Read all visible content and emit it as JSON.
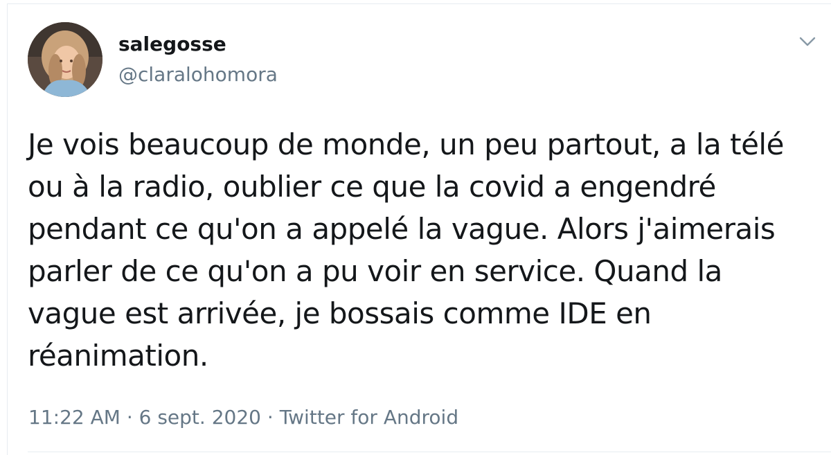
{
  "tweet": {
    "display_name": "salegosse",
    "handle": "@claralohomora",
    "text_lines": [
      "Je vois beaucoup de monde, un peu partout, a la télé",
      "ou à la radio, oublier ce que la covid a engendré",
      "pendant ce qu'on a appelé la vague. Alors j'aimerais",
      "parler de ce qu'on a pu voir en service. Quand la",
      "vague est arrivée, je bossais comme IDE en",
      "réanimation."
    ],
    "time": "11:22 AM",
    "date": "6 sept. 2020",
    "source": "Twitter for Android",
    "separator": "·"
  },
  "icons": {
    "avatar": "avatar-photo",
    "menu": "chevron-down-icon"
  },
  "colors": {
    "text_primary": "#14171a",
    "text_secondary": "#657786",
    "caret": "#8899a6",
    "border": "#e6ecf0"
  }
}
